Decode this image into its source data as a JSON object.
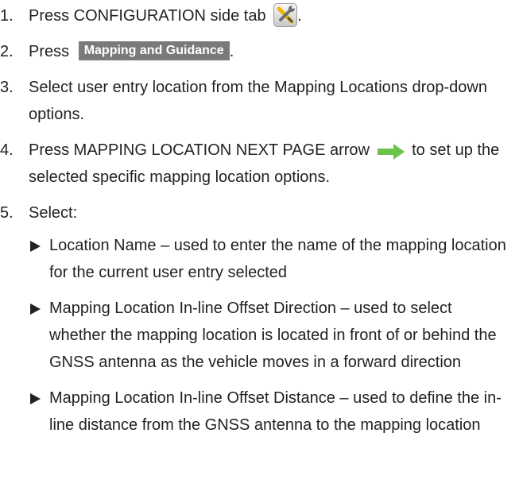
{
  "steps": [
    {
      "num": "1.",
      "text_before": "Press CONFIGURATION side tab",
      "icon": "tools-icon",
      "text_after": "."
    },
    {
      "num": "2.",
      "text_before": "Press",
      "button_label": "Mapping and Guidance",
      "text_after": "."
    },
    {
      "num": "3.",
      "text": "Select user entry location from the Mapping Locations drop-down options."
    },
    {
      "num": "4.",
      "text_before": "Press MAPPING LOCATION NEXT PAGE arrow",
      "icon": "green-right-arrow-icon",
      "text_after": "to set up the selected specific mapping location options."
    },
    {
      "num": "5.",
      "text": "Select:"
    }
  ],
  "bullets": [
    "Location Name – used to enter the name of the mapping location for the current user entry selected",
    "Mapping Location In-line Offset Direction – used to select whether the mapping location is located in front of or behind the GNSS antenna as the vehicle moves in a forward direction",
    "Mapping Location In-line Offset Distance – used to define the in-line distance from the GNSS antenna to the mapping location"
  ],
  "colors": {
    "text": "#222222",
    "button_bg": "#7a7a7a",
    "arrow_green": "#6cc24a"
  }
}
